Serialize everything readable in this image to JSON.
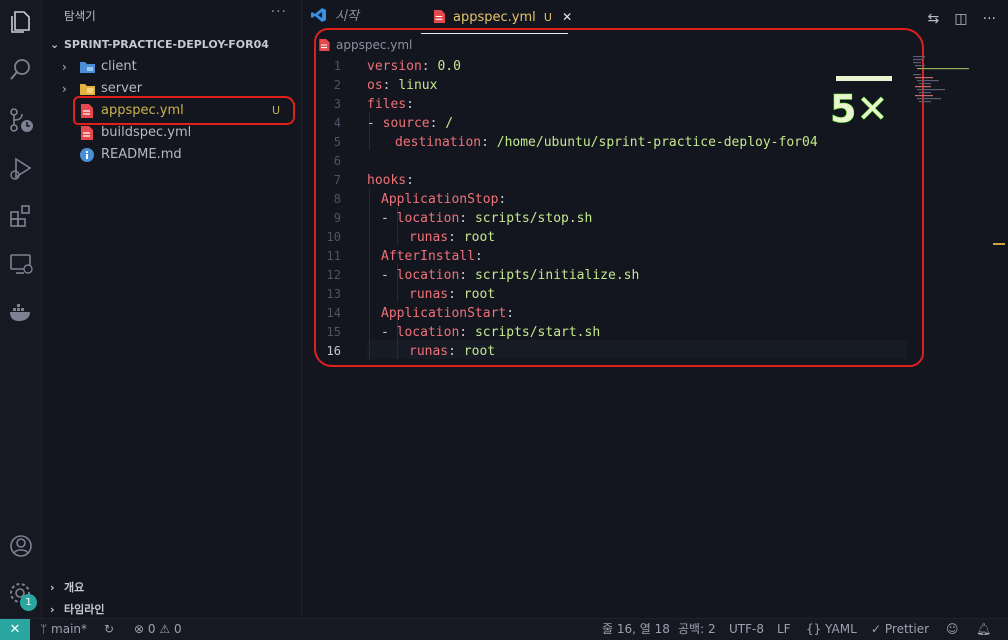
{
  "sidebar": {
    "title": "탐색기",
    "more": "···",
    "project": "SPRINT-PRACTICE-DEPLOY-FOR04",
    "items": [
      {
        "label": "client",
        "type": "folder"
      },
      {
        "label": "server",
        "type": "folder"
      },
      {
        "label": "appspec.yml",
        "type": "yaml",
        "git": "U"
      },
      {
        "label": "buildspec.yml",
        "type": "yaml"
      },
      {
        "label": "README.md",
        "type": "info"
      }
    ],
    "outline": "개요",
    "timeline": "타임라인"
  },
  "tabs": {
    "start": "시작",
    "active": "appspec.yml",
    "active_status": "U",
    "close": "✕"
  },
  "editor": {
    "breadcrumb": "appspec.yml",
    "annotation": "5✕",
    "line_numbers": [
      "1",
      "2",
      "3",
      "4",
      "5",
      "6",
      "7",
      "8",
      "9",
      "10",
      "11",
      "12",
      "13",
      "14",
      "15",
      "16"
    ],
    "lines": [
      {
        "key": "version",
        "value": "0.0"
      },
      {
        "key": "os",
        "value": "linux"
      },
      {
        "key": "files",
        "value": ""
      },
      {
        "dash": true,
        "key": "source",
        "value": "/"
      },
      {
        "key": "destination",
        "value": "/home/ubuntu/sprint-practice-deploy-for04"
      },
      {
        "key": "",
        "value": ""
      },
      {
        "key": "hooks",
        "value": ""
      },
      {
        "key": "ApplicationStop",
        "value": ""
      },
      {
        "dash": true,
        "key": "location",
        "value": "scripts/stop.sh"
      },
      {
        "key": "runas",
        "value": "root"
      },
      {
        "key": "AfterInstall",
        "value": ""
      },
      {
        "dash": true,
        "key": "location",
        "value": "scripts/initialize.sh"
      },
      {
        "key": "runas",
        "value": "root"
      },
      {
        "key": "ApplicationStart",
        "value": ""
      },
      {
        "dash": true,
        "key": "location",
        "value": "scripts/start.sh"
      },
      {
        "key": "runas",
        "value": "root"
      }
    ]
  },
  "status": {
    "branch": "main*",
    "errors": "0",
    "warnings": "0",
    "position": "줄 16, 열 18",
    "spaces": "공백: 2",
    "encoding": "UTF-8",
    "eol": "LF",
    "language": "YAML",
    "formatter": "Prettier",
    "settings_badge": "1"
  },
  "colors": {
    "accent": "#2aa6a0",
    "annotation": "#e0201c",
    "yaml_key": "#f07178",
    "yaml_value": "#c3e88d"
  }
}
